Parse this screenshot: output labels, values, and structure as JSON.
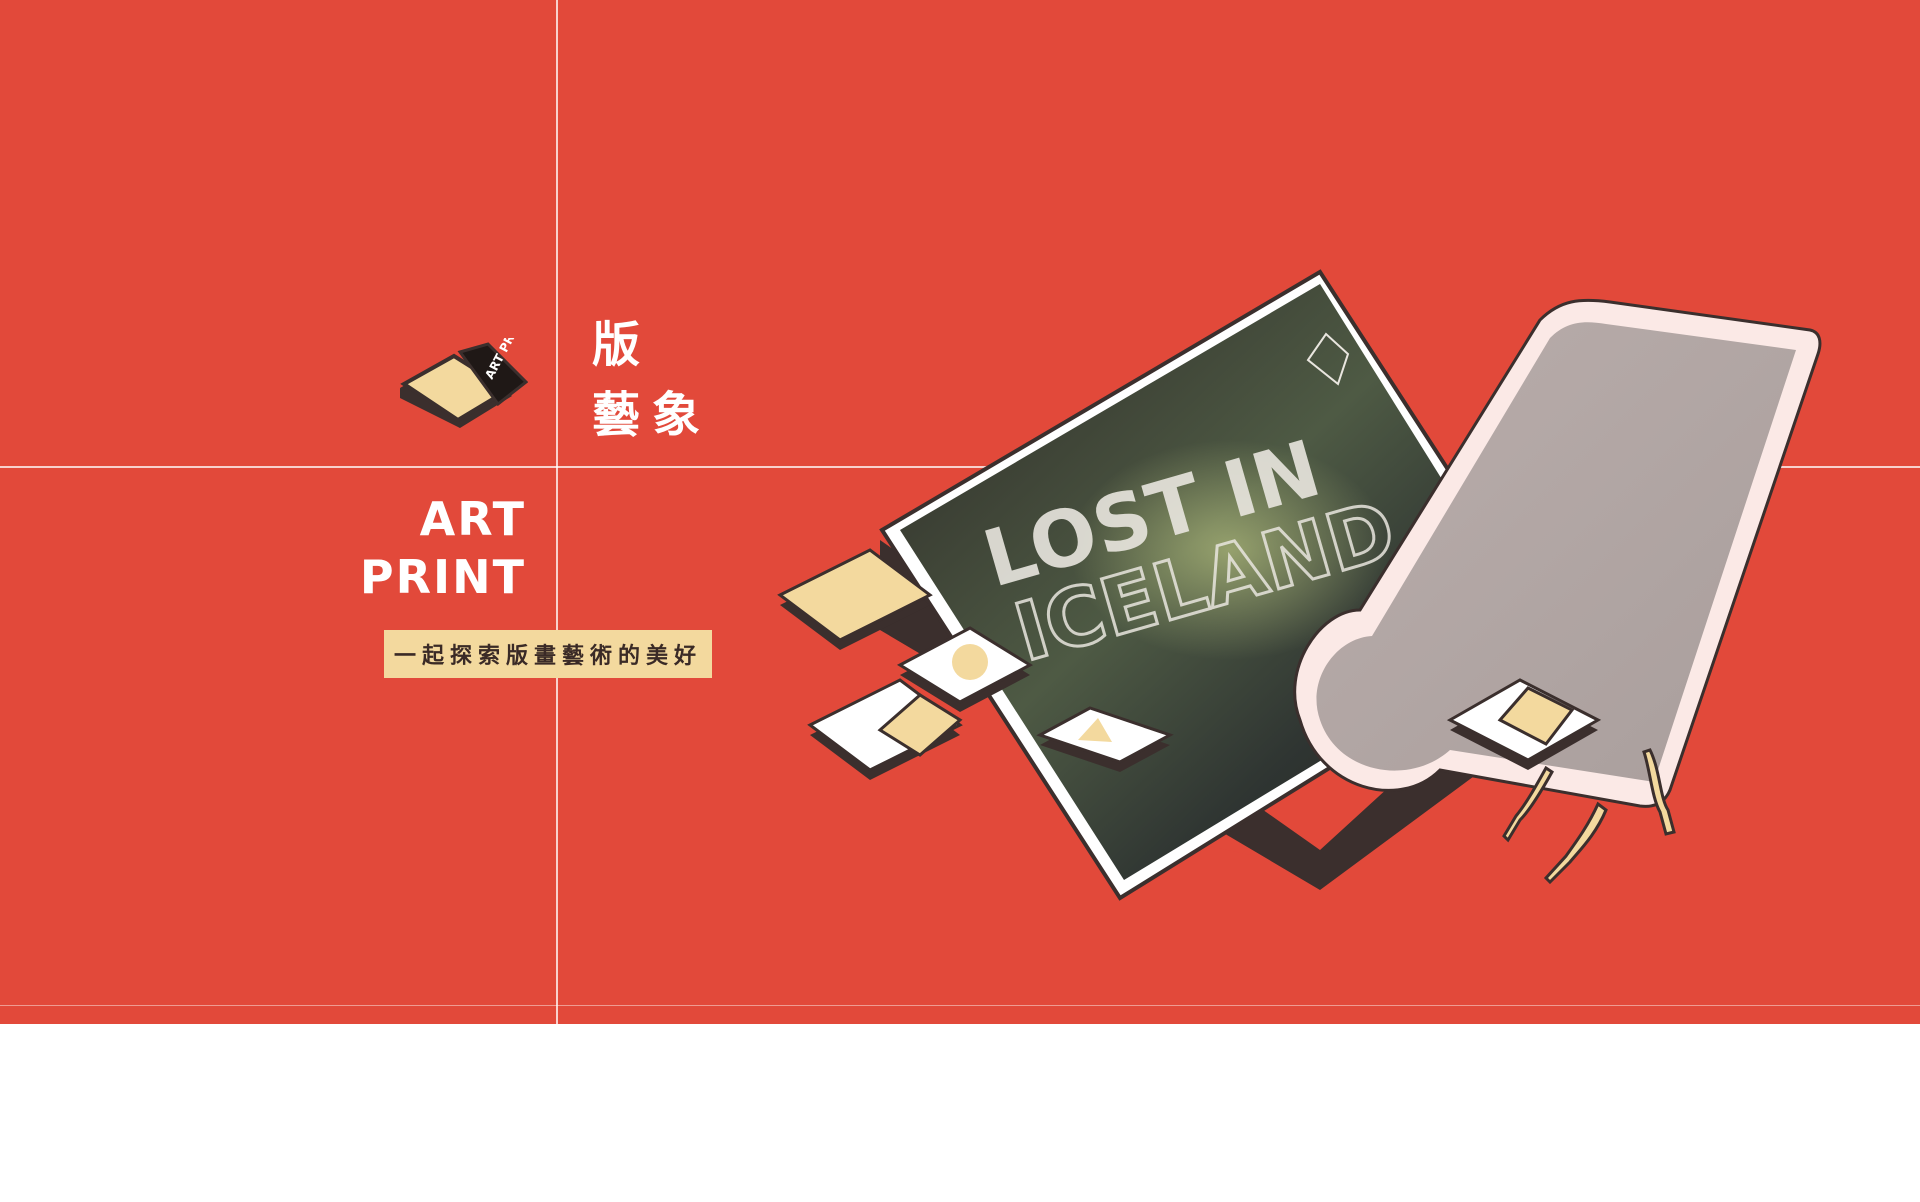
{
  "brand": {
    "title_zh_line1": "版",
    "title_zh_line2": "藝象",
    "title_en_line1": "ART",
    "title_en_line2": "PRINT",
    "tagline": "一起探索版畫藝術的美好",
    "logo_text": "ART PRINT"
  },
  "artwork": {
    "print_text_line1": "LOST IN",
    "print_text_line2": "ICELAND"
  },
  "colors": {
    "background": "#e2493a",
    "tagline_bg": "#f3d99e",
    "box_dark": "#3b2f2d",
    "paper": "#f3d99e"
  }
}
